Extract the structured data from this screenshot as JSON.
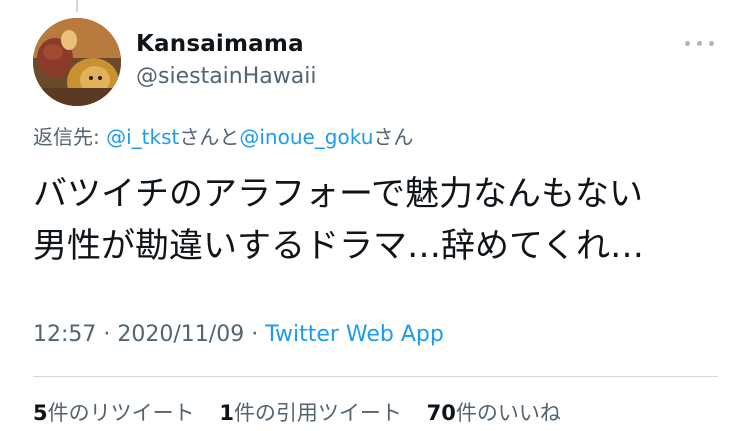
{
  "user": {
    "display_name": "Kansaimama",
    "handle": "@siestainHawaii"
  },
  "icons": {
    "more": "more-horizontal-icon",
    "avatar": "lion-king-avatar"
  },
  "reply": {
    "prefix": "返信先: ",
    "mention1": "@i_tkst",
    "joiner": "さんと",
    "mention2": "@inoue_goku",
    "suffix": "さん"
  },
  "tweet": {
    "line1": "バツイチのアラフォーで魅力なんもない",
    "line2": "男性が勘違いするドラマ…辞めてくれ…"
  },
  "meta": {
    "time": "12:57",
    "sep1": " · ",
    "date": "2020/11/09",
    "sep2": " · ",
    "source": "Twitter Web App"
  },
  "stats": {
    "retweets_count": "5",
    "retweets_label": "件のリツイート",
    "quotes_count": "1",
    "quotes_label": "件の引用ツイート",
    "likes_count": "70",
    "likes_label": "件のいいね"
  },
  "colors": {
    "link": "#1d9bf0",
    "secondary": "#536471",
    "primary": "#0f1419"
  }
}
